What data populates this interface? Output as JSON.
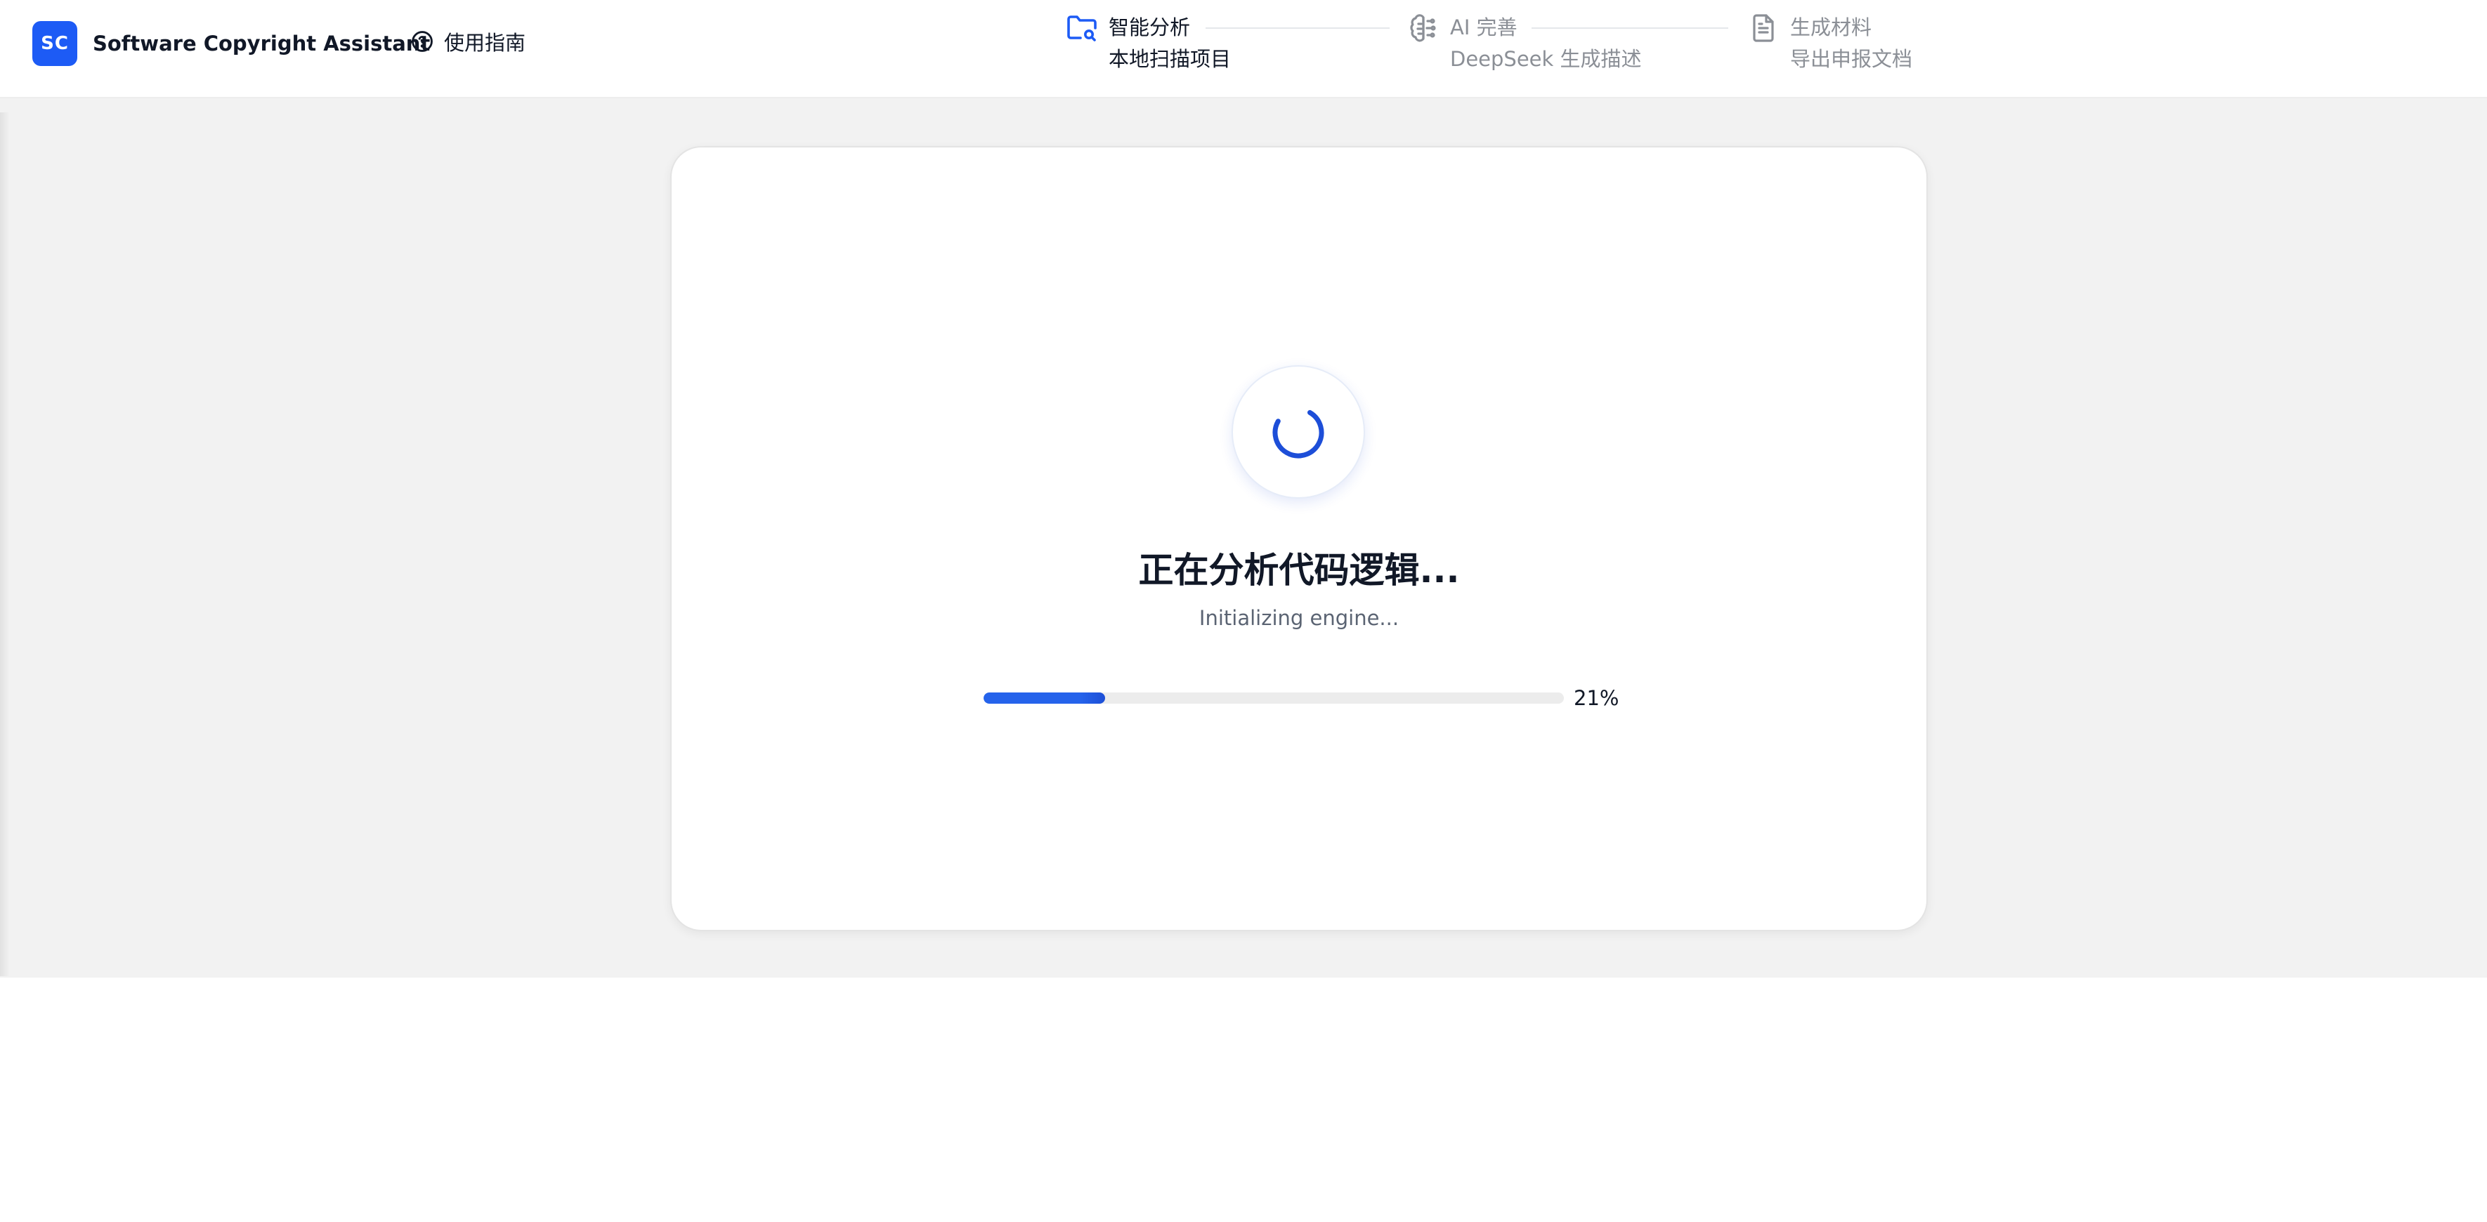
{
  "header": {
    "logo_text": "SC",
    "app_name": "Software Copyright Assistant",
    "guide_label": "使用指南",
    "guide_icon": "help-circle-icon"
  },
  "stepper": {
    "steps": [
      {
        "title": "智能分析",
        "subtitle": "本地扫描项目",
        "icon": "folder-search-icon",
        "state": "active"
      },
      {
        "title": "AI 完善",
        "subtitle": "DeepSeek 生成描述",
        "icon": "brain-icon",
        "state": "inactive"
      },
      {
        "title": "生成材料",
        "subtitle": "导出申报文档",
        "icon": "file-text-icon",
        "state": "inactive"
      }
    ]
  },
  "main": {
    "status_title": "正在分析代码逻辑...",
    "status_subtitle": "Initializing engine...",
    "progress_percent": 21,
    "progress_label": "21%"
  },
  "colors": {
    "accent": "#1d5bf5",
    "progress": "#2563eb",
    "background": "#f2f2f2"
  }
}
